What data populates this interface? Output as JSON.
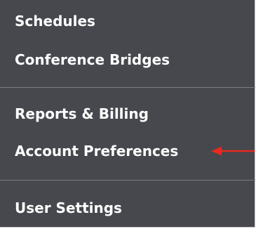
{
  "menu": {
    "items": [
      {
        "label": "Schedules"
      },
      {
        "label": "Conference Bridges"
      },
      {
        "label": "Reports & Billing"
      },
      {
        "label": "Account Preferences"
      },
      {
        "label": "User Settings"
      }
    ]
  },
  "annotation": {
    "icon": "arrow-left-icon",
    "color": "#e8291e"
  },
  "colors": {
    "menu_background": "#46484e",
    "text": "#ffffff",
    "divider": "#7a7c81"
  }
}
